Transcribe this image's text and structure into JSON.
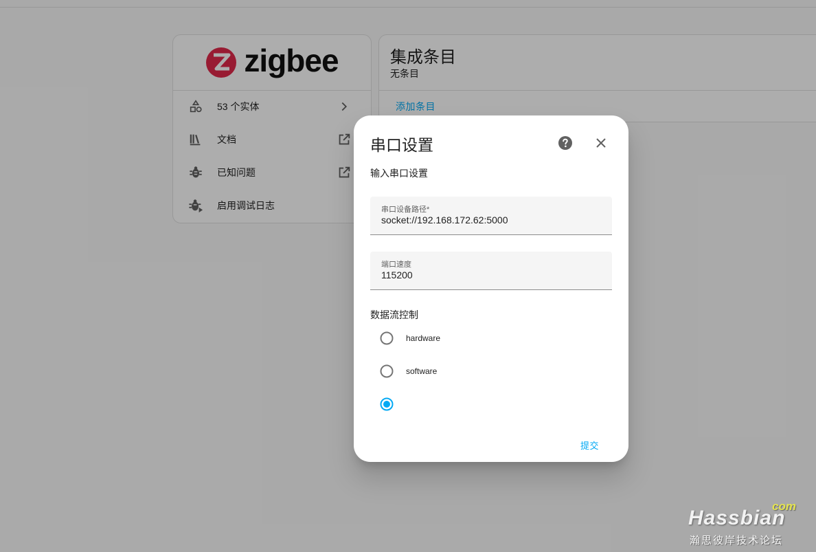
{
  "left_card": {
    "logo_text": "zigbee",
    "menu": [
      {
        "label": "53 个实体",
        "icon": "shapes-icon",
        "trail": "chevron-right-icon"
      },
      {
        "label": "文档",
        "icon": "library-icon",
        "trail": "open-in-new-icon"
      },
      {
        "label": "已知问题",
        "icon": "bug-icon",
        "trail": "open-in-new-icon"
      },
      {
        "label": "启用调试日志",
        "icon": "bug-play-icon",
        "trail": ""
      }
    ]
  },
  "right_card": {
    "title": "集成条目",
    "subtitle": "无条目",
    "action": "添加条目"
  },
  "dialog": {
    "title": "串口设置",
    "description": "输入串口设置",
    "fields": {
      "path": {
        "label": "串口设备路径*",
        "value": "socket://192.168.172.62:5000"
      },
      "baudrate": {
        "label": "端口速度",
        "value": "115200"
      }
    },
    "flow_control": {
      "label": "数据流控制",
      "options": [
        {
          "label": "hardware",
          "selected": false
        },
        {
          "label": "software",
          "selected": false
        },
        {
          "label": "",
          "selected": true
        }
      ]
    },
    "submit": "提交"
  },
  "watermark": {
    "main": "Hassbian",
    "com": "com",
    "sub": "瀚思彼岸技术论坛"
  },
  "colors": {
    "accent": "#03a9f4",
    "scrim": "rgba(0,0,0,0.32)",
    "zigbee_red": "#e0284a"
  }
}
